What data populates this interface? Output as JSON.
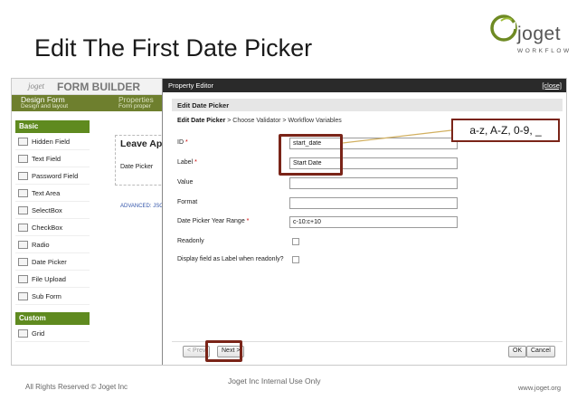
{
  "slide": {
    "title": "Edit The First Date Picker",
    "logo_word": "joget",
    "logo_sub": "WORKFLOW",
    "footer_left": "All Rights Reserved © Joget Inc",
    "footer_center": "Joget Inc Internal Use Only",
    "footer_right": "www.joget.org",
    "callout": "a-z, A-Z, 0-9, _"
  },
  "builder": {
    "logo": "joget",
    "title": "FORM BUILDER",
    "tab_design": "Design Form",
    "tab_design_sub": "Design and layout",
    "tab_props": "Properties",
    "tab_props_sub": "Form proper",
    "palette_basic": "Basic",
    "palette_custom": "Custom",
    "palette_items": [
      {
        "label": "Hidden Field",
        "icon": "hidden-field-icon"
      },
      {
        "label": "Text Field",
        "icon": "text-field-icon"
      },
      {
        "label": "Password Field",
        "icon": "password-field-icon"
      },
      {
        "label": "Text Area",
        "icon": "text-area-icon"
      },
      {
        "label": "SelectBox",
        "icon": "selectbox-icon"
      },
      {
        "label": "CheckBox",
        "icon": "checkbox-icon"
      },
      {
        "label": "Radio",
        "icon": "radio-icon"
      },
      {
        "label": "Date Picker",
        "icon": "date-picker-icon"
      },
      {
        "label": "File Upload",
        "icon": "file-upload-icon"
      },
      {
        "label": "Sub Form",
        "icon": "sub-form-icon"
      }
    ],
    "custom_items": [
      {
        "label": "Grid",
        "icon": "grid-icon"
      }
    ],
    "canvas_title": "Leave App",
    "canvas_field": "Date Picker",
    "advanced_link": "ADVANCED: JSON"
  },
  "dialog": {
    "title": "Property Editor",
    "close": "[close]",
    "section": "Edit Date Picker",
    "crumb_current": "Edit Date Picker",
    "crumb_rest": " > Choose Validator > Workflow Variables",
    "fields": {
      "id_label": "ID",
      "id_value": "start_date",
      "label_label": "Label",
      "label_value": "Start Date",
      "value_label": "Value",
      "value_value": "",
      "format_label": "Format",
      "format_value": "",
      "range_label": "Date Picker Year Range",
      "range_value": "c-10:c+10",
      "readonly_label": "Readonly",
      "display_label": "Display field as Label when readonly?"
    },
    "required_mark": "*",
    "buttons": {
      "prev": "< Prev",
      "next": "Next >",
      "ok": "OK",
      "cancel": "Cancel"
    }
  }
}
